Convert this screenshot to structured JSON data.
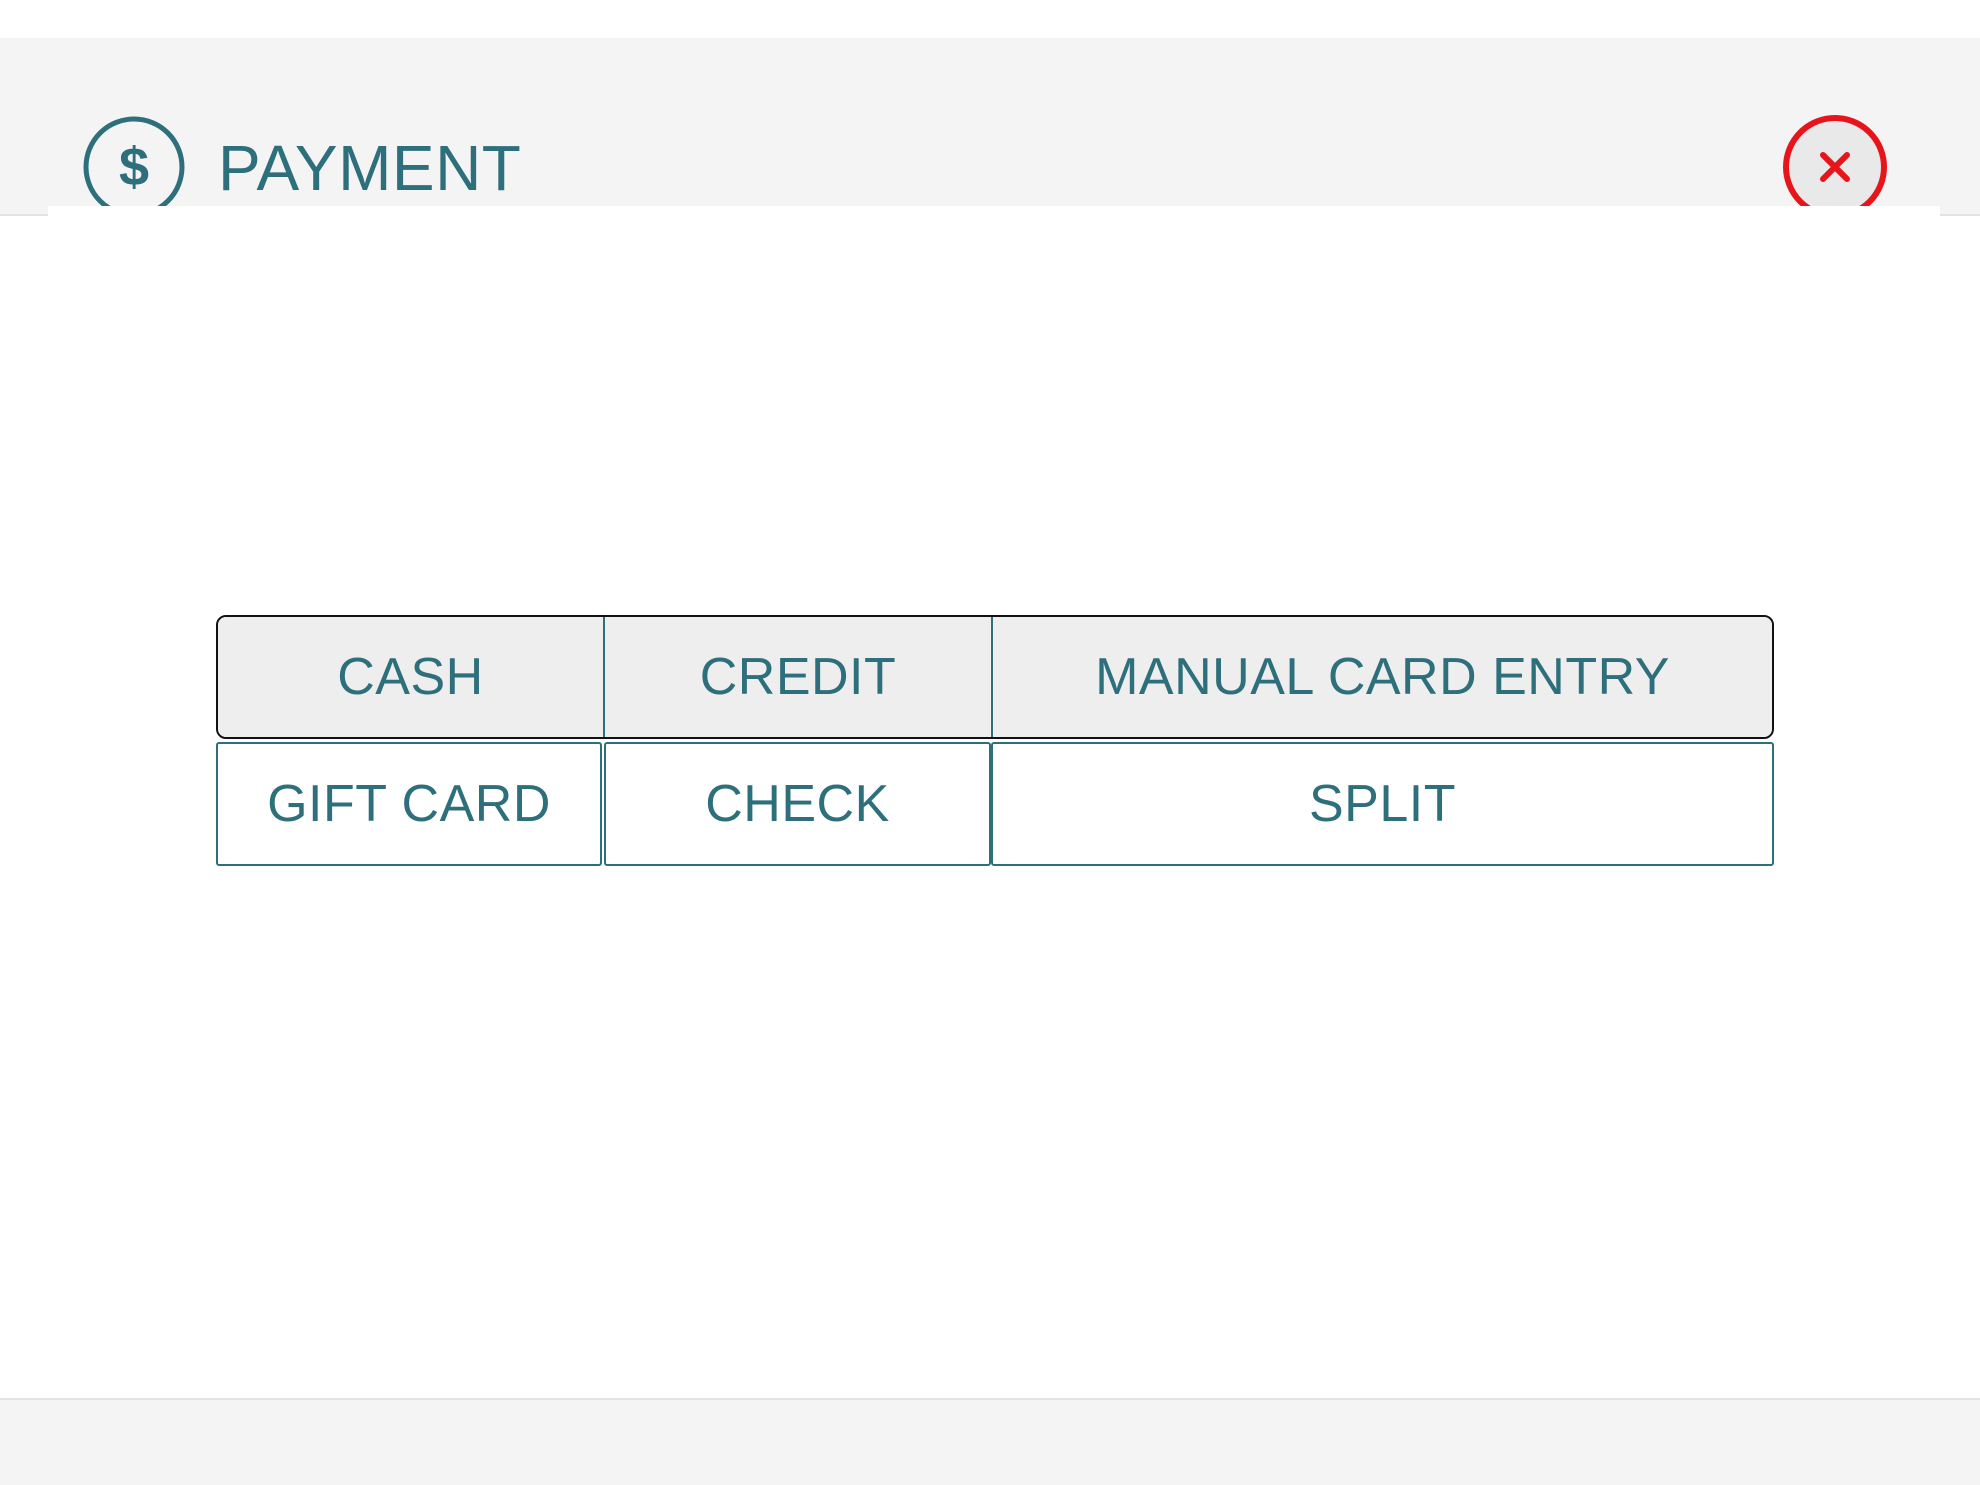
{
  "dialog": {
    "title": "PAYMENT",
    "header_icon": "dollar-circle-icon",
    "close_icon": "close-x-icon",
    "accent_color": "#2e6f7c",
    "close_color": "#e8141b"
  },
  "payment_options": {
    "row1": [
      "CASH",
      "CREDIT",
      "MANUAL CARD ENTRY"
    ],
    "row2": [
      "GIFT CARD",
      "CHECK",
      "SPLIT"
    ]
  }
}
